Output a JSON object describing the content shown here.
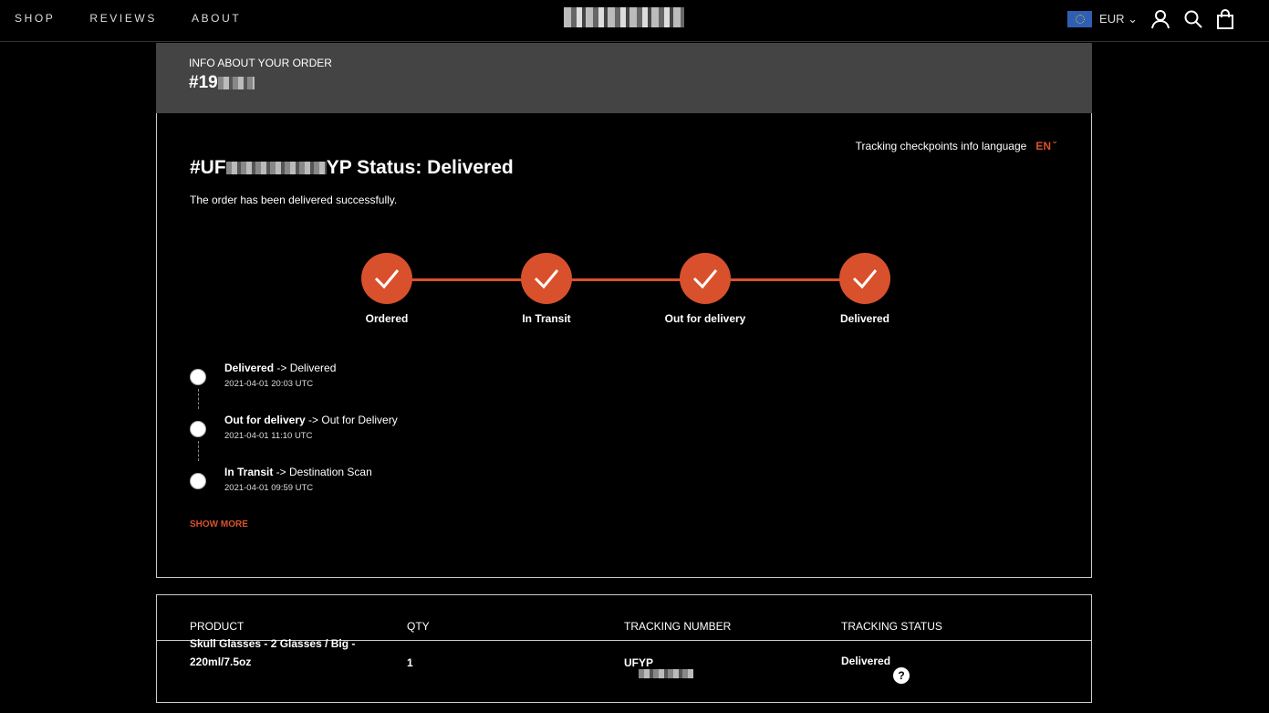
{
  "nav": {
    "links": [
      "SHOP",
      "REVIEWS",
      "ABOUT"
    ],
    "currency": "EUR"
  },
  "order": {
    "label": "INFO ABOUT YOUR ORDER",
    "number": "#19"
  },
  "tracking": {
    "language_label": "Tracking checkpoints info language",
    "language": "EN",
    "title_prefix": "#UF",
    "title_suffix": "YP Status: Delivered",
    "message": "The order has been delivered successfully.",
    "steps": [
      "Ordered",
      "In Transit",
      "Out for delivery",
      "Delivered"
    ],
    "events": [
      {
        "status": "Delivered",
        "detail": " -> Delivered",
        "time": "2021-04-01 20:03 UTC"
      },
      {
        "status": "Out for delivery",
        "detail": " -> Out for Delivery",
        "time": "2021-04-01 11:10 UTC"
      },
      {
        "status": "In Transit",
        "detail": " -> Destination Scan",
        "time": "2021-04-01 09:59 UTC"
      }
    ],
    "show_more": "SHOW MORE"
  },
  "table": {
    "headers": [
      "PRODUCT",
      "QTY",
      "TRACKING NUMBER",
      "TRACKING STATUS"
    ],
    "row": {
      "product_line1": "Skull Glasses - 2 Glasses / Big -",
      "product_line2": "220ml/7.5oz",
      "qty": "1",
      "tracking_prefix": "UF",
      "tracking_suffix": "YP",
      "status": "Delivered"
    }
  },
  "colors": {
    "accent": "#d9512c",
    "header_bg": "#444444"
  }
}
